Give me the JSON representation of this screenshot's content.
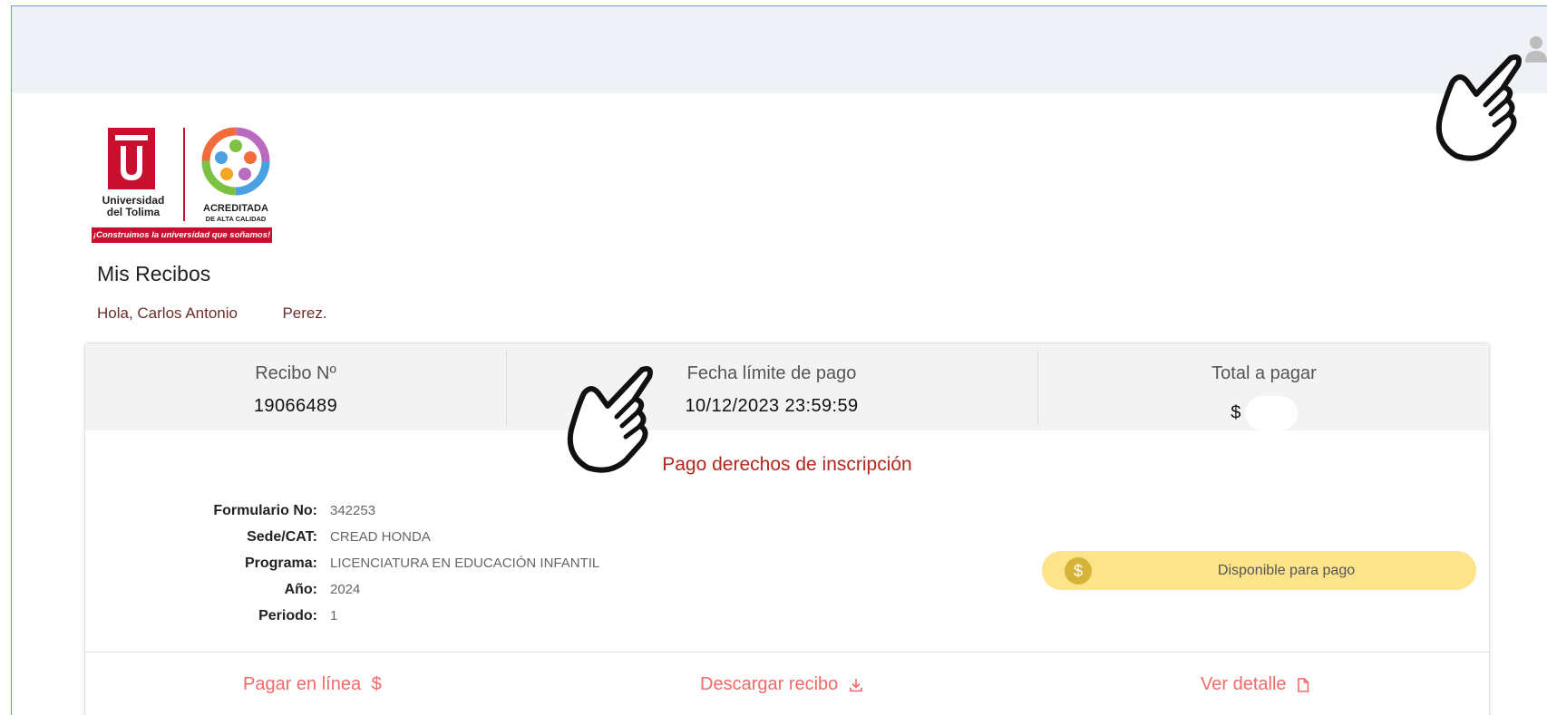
{
  "logo": {
    "university_name_line1": "Universidad",
    "university_name_line2": "del Tolima",
    "accreditation_line1": "ACREDITADA",
    "accreditation_line2": "DE ALTA CALIDAD",
    "slogan": "¡Construimos la universidad que soñamos!",
    "brand_color": "#c8102e"
  },
  "page": {
    "title": "Mis Recibos",
    "greeting_prefix": "Hola, Carlos Antonio",
    "greeting_suffix": "Perez."
  },
  "receipt": {
    "number_label": "Recibo Nº",
    "number_value": "19066489",
    "deadline_label": "Fecha límite de pago",
    "deadline_value": "10/12/2023 23:59:59",
    "total_label": "Total a pagar",
    "total_currency": "$",
    "concept": "Pago derechos de inscripción",
    "details": [
      {
        "key": "Formulario No:",
        "value": "342253"
      },
      {
        "key": "Sede/CAT:",
        "value": "CREAD HONDA"
      },
      {
        "key": "Programa:",
        "value": "LICENCIATURA EN EDUCACIÓN INFANTIL"
      },
      {
        "key": "Año:",
        "value": "2024"
      },
      {
        "key": "Periodo:",
        "value": "1"
      }
    ],
    "status": "Disponible para pago",
    "status_icon": "$",
    "status_color": "#fde38a"
  },
  "actions": {
    "pay_online": "Pagar en línea",
    "pay_online_icon": "$",
    "download": "Descargar recibo",
    "view_detail": "Ver detalle",
    "link_color": "#f26868"
  },
  "icons": [
    "user-avatar-icon",
    "pointing-hand-icon",
    "dollar-icon",
    "download-icon",
    "document-icon"
  ]
}
